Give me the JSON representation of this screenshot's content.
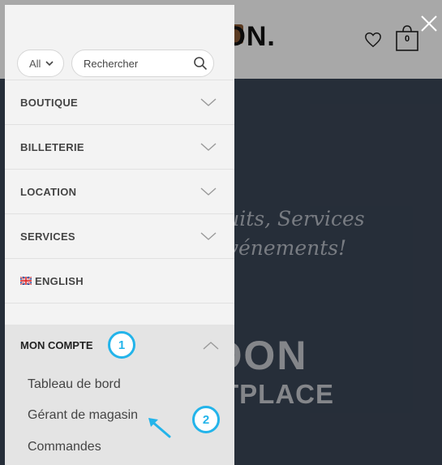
{
  "header": {
    "logo_text": "MADON.",
    "cart_count": "0"
  },
  "hero": {
    "slogan_line1": "Achetez Produits, Services",
    "slogan_line2": "et Tickets événements!",
    "title": "MADON",
    "subtitle": "MARKETPLACE"
  },
  "search": {
    "category_selected": "All",
    "placeholder": "Rechercher"
  },
  "menu": {
    "items": [
      {
        "label": "BOUTIQUE"
      },
      {
        "label": "BILLETERIE"
      },
      {
        "label": "LOCATION"
      },
      {
        "label": "SERVICES"
      }
    ],
    "language": {
      "label": "ENGLISH",
      "flag": "uk-flag-icon"
    },
    "account": {
      "label": "MON COMPTE",
      "expanded": true,
      "links": [
        {
          "label": "Tableau de bord"
        },
        {
          "label": "Gérant de magasin"
        },
        {
          "label": "Commandes"
        }
      ]
    }
  },
  "annotations": {
    "callout1": "1",
    "callout2": "2",
    "color": "#23b4ea"
  },
  "icons": {
    "close": "close-icon",
    "wishlist": "heart-icon",
    "cart": "shopping-bag-icon",
    "search": "search-icon"
  }
}
